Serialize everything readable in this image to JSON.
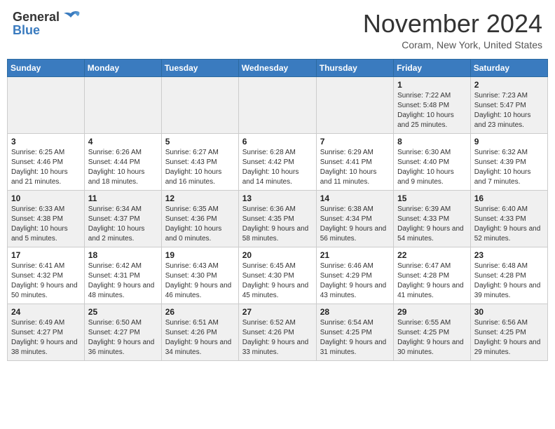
{
  "header": {
    "logo_general": "General",
    "logo_blue": "Blue",
    "month_title": "November 2024",
    "location": "Coram, New York, United States"
  },
  "weekdays": [
    "Sunday",
    "Monday",
    "Tuesday",
    "Wednesday",
    "Thursday",
    "Friday",
    "Saturday"
  ],
  "weeks": [
    [
      {
        "day": "",
        "info": ""
      },
      {
        "day": "",
        "info": ""
      },
      {
        "day": "",
        "info": ""
      },
      {
        "day": "",
        "info": ""
      },
      {
        "day": "",
        "info": ""
      },
      {
        "day": "1",
        "info": "Sunrise: 7:22 AM\nSunset: 5:48 PM\nDaylight: 10 hours and 25 minutes."
      },
      {
        "day": "2",
        "info": "Sunrise: 7:23 AM\nSunset: 5:47 PM\nDaylight: 10 hours and 23 minutes."
      }
    ],
    [
      {
        "day": "3",
        "info": "Sunrise: 6:25 AM\nSunset: 4:46 PM\nDaylight: 10 hours and 21 minutes."
      },
      {
        "day": "4",
        "info": "Sunrise: 6:26 AM\nSunset: 4:44 PM\nDaylight: 10 hours and 18 minutes."
      },
      {
        "day": "5",
        "info": "Sunrise: 6:27 AM\nSunset: 4:43 PM\nDaylight: 10 hours and 16 minutes."
      },
      {
        "day": "6",
        "info": "Sunrise: 6:28 AM\nSunset: 4:42 PM\nDaylight: 10 hours and 14 minutes."
      },
      {
        "day": "7",
        "info": "Sunrise: 6:29 AM\nSunset: 4:41 PM\nDaylight: 10 hours and 11 minutes."
      },
      {
        "day": "8",
        "info": "Sunrise: 6:30 AM\nSunset: 4:40 PM\nDaylight: 10 hours and 9 minutes."
      },
      {
        "day": "9",
        "info": "Sunrise: 6:32 AM\nSunset: 4:39 PM\nDaylight: 10 hours and 7 minutes."
      }
    ],
    [
      {
        "day": "10",
        "info": "Sunrise: 6:33 AM\nSunset: 4:38 PM\nDaylight: 10 hours and 5 minutes."
      },
      {
        "day": "11",
        "info": "Sunrise: 6:34 AM\nSunset: 4:37 PM\nDaylight: 10 hours and 2 minutes."
      },
      {
        "day": "12",
        "info": "Sunrise: 6:35 AM\nSunset: 4:36 PM\nDaylight: 10 hours and 0 minutes."
      },
      {
        "day": "13",
        "info": "Sunrise: 6:36 AM\nSunset: 4:35 PM\nDaylight: 9 hours and 58 minutes."
      },
      {
        "day": "14",
        "info": "Sunrise: 6:38 AM\nSunset: 4:34 PM\nDaylight: 9 hours and 56 minutes."
      },
      {
        "day": "15",
        "info": "Sunrise: 6:39 AM\nSunset: 4:33 PM\nDaylight: 9 hours and 54 minutes."
      },
      {
        "day": "16",
        "info": "Sunrise: 6:40 AM\nSunset: 4:33 PM\nDaylight: 9 hours and 52 minutes."
      }
    ],
    [
      {
        "day": "17",
        "info": "Sunrise: 6:41 AM\nSunset: 4:32 PM\nDaylight: 9 hours and 50 minutes."
      },
      {
        "day": "18",
        "info": "Sunrise: 6:42 AM\nSunset: 4:31 PM\nDaylight: 9 hours and 48 minutes."
      },
      {
        "day": "19",
        "info": "Sunrise: 6:43 AM\nSunset: 4:30 PM\nDaylight: 9 hours and 46 minutes."
      },
      {
        "day": "20",
        "info": "Sunrise: 6:45 AM\nSunset: 4:30 PM\nDaylight: 9 hours and 45 minutes."
      },
      {
        "day": "21",
        "info": "Sunrise: 6:46 AM\nSunset: 4:29 PM\nDaylight: 9 hours and 43 minutes."
      },
      {
        "day": "22",
        "info": "Sunrise: 6:47 AM\nSunset: 4:28 PM\nDaylight: 9 hours and 41 minutes."
      },
      {
        "day": "23",
        "info": "Sunrise: 6:48 AM\nSunset: 4:28 PM\nDaylight: 9 hours and 39 minutes."
      }
    ],
    [
      {
        "day": "24",
        "info": "Sunrise: 6:49 AM\nSunset: 4:27 PM\nDaylight: 9 hours and 38 minutes."
      },
      {
        "day": "25",
        "info": "Sunrise: 6:50 AM\nSunset: 4:27 PM\nDaylight: 9 hours and 36 minutes."
      },
      {
        "day": "26",
        "info": "Sunrise: 6:51 AM\nSunset: 4:26 PM\nDaylight: 9 hours and 34 minutes."
      },
      {
        "day": "27",
        "info": "Sunrise: 6:52 AM\nSunset: 4:26 PM\nDaylight: 9 hours and 33 minutes."
      },
      {
        "day": "28",
        "info": "Sunrise: 6:54 AM\nSunset: 4:25 PM\nDaylight: 9 hours and 31 minutes."
      },
      {
        "day": "29",
        "info": "Sunrise: 6:55 AM\nSunset: 4:25 PM\nDaylight: 9 hours and 30 minutes."
      },
      {
        "day": "30",
        "info": "Sunrise: 6:56 AM\nSunset: 4:25 PM\nDaylight: 9 hours and 29 minutes."
      }
    ]
  ]
}
